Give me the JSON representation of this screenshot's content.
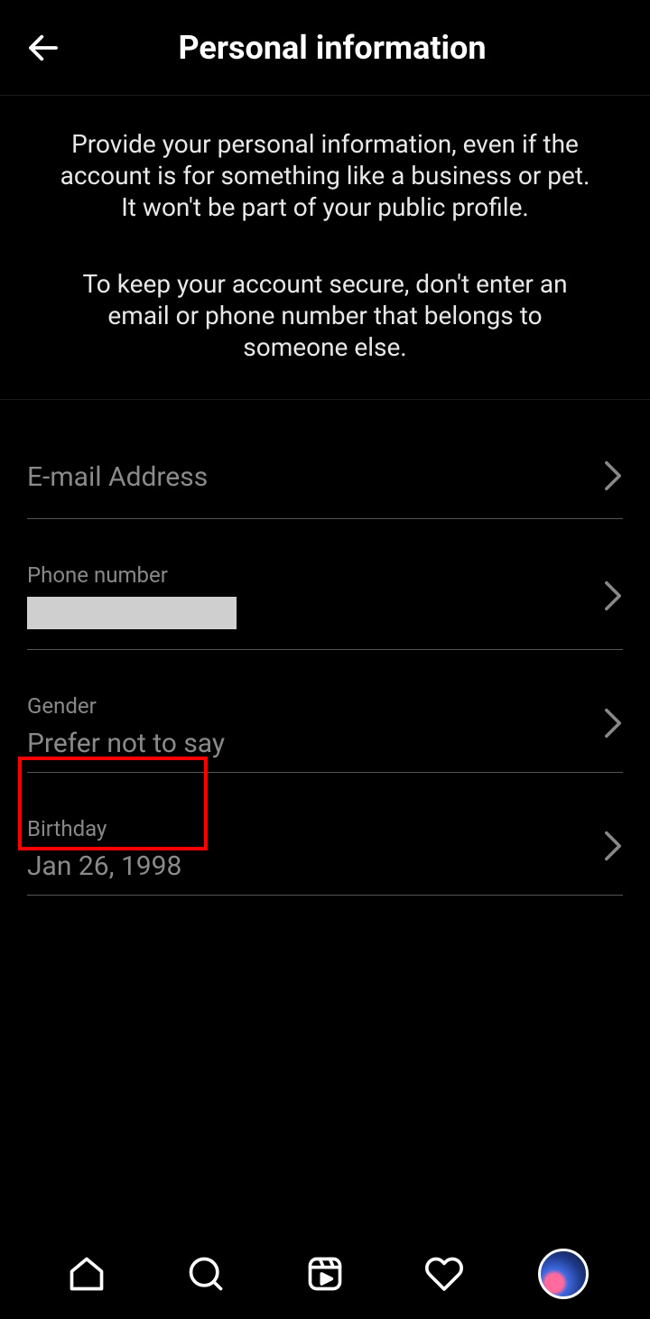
{
  "header": {
    "title": "Personal information"
  },
  "info": {
    "para1": "Provide your personal information, even if the account is for something like a business or pet. It won't be part of your public profile.",
    "para2": "To keep your account secure, don't enter an email or phone number that belongs to someone else."
  },
  "fields": {
    "email": {
      "label": "E-mail Address"
    },
    "phone": {
      "label": "Phone number",
      "value": ""
    },
    "gender": {
      "label": "Gender",
      "value": "Prefer not to say"
    },
    "birthday": {
      "label": "Birthday",
      "value": "Jan 26, 1998"
    }
  }
}
